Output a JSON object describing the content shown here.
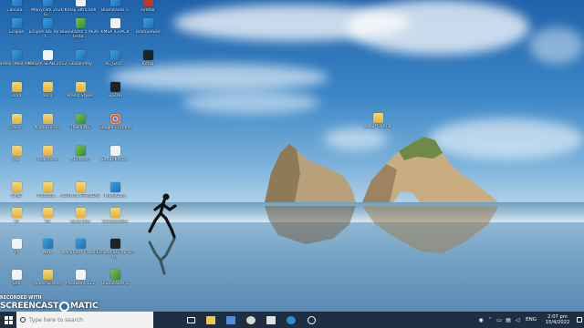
{
  "desktop": {
    "icons": [
      {
        "label": "Calcula..."
      },
      {
        "label": "Manycam 2020 G..."
      },
      {
        "label": "Kmsp ultra bell"
      },
      {
        "label": "BlueStacks 5"
      },
      {
        "label": "Firefox"
      },
      {
        "label": "Eclipse"
      },
      {
        "label": "Eclipse IDE for Ent..."
      },
      {
        "label": "BlueStacks 5 Multi-Insta..."
      },
      {
        "label": "KMSP ICRACK"
      },
      {
        "label": "Teamviewer"
      },
      {
        "label": "Firefox (Mod Mod)"
      },
      {
        "label": "NVIDIA SLAB 2012"
      },
      {
        "label": "GlasanPlay"
      },
      {
        "label": "AL_Gl.U..."
      },
      {
        "label": "Kmsp"
      },
      {
        "label": "D/Vd"
      },
      {
        "label": "asco"
      },
      {
        "label": "Prediz Styles"
      },
      {
        "label": "Glasser"
      },
      {
        "label": "Crash..."
      },
      {
        "label": "KomunVirus"
      },
      {
        "label": "Thwla IKC"
      },
      {
        "label": "Google Chrome"
      },
      {
        "label": "Mo."
      },
      {
        "label": "Realchess"
      },
      {
        "label": "ACPlayer"
      },
      {
        "label": "Setup-KYLC..."
      },
      {
        "label": "CMD"
      },
      {
        "label": "Protocol..."
      },
      {
        "label": "NORMAL STANDAR"
      },
      {
        "label": "ManyCam"
      },
      {
        "label": "ld"
      },
      {
        "label": "Tai"
      },
      {
        "label": "ea ju una"
      },
      {
        "label": "Screenshots"
      },
      {
        "label": "Pi"
      },
      {
        "label": "New"
      },
      {
        "label": "ManyCam Video..."
      },
      {
        "label": "Eclipse IDE for Ent..."
      },
      {
        "label": "Sec"
      },
      {
        "label": "Video Screen"
      },
      {
        "label": "Password 123"
      },
      {
        "label": "BlueStacks 5"
      },
      {
        "label": "KMSP CRACK"
      }
    ]
  },
  "watermark": {
    "recorded_with": "RECORDED WITH",
    "brand": "SCREENCAST",
    "brand_suffix": "MATIC"
  },
  "taskbar": {
    "search_placeholder": "Type here to search",
    "apps": [
      {
        "icon": "task-view-icon"
      },
      {
        "icon": "file-explorer-icon"
      },
      {
        "icon": "mail-icon"
      },
      {
        "icon": "teamviewer-icon"
      },
      {
        "icon": "files-icon"
      },
      {
        "icon": "edge-icon"
      },
      {
        "icon": "obs-icon"
      }
    ],
    "tray": {
      "language": "ENG",
      "time": "2:07 pm",
      "date": "15/4/2022"
    }
  },
  "colors": {
    "taskbar": "#1f2f43",
    "sky_top": "#1f62a9"
  }
}
